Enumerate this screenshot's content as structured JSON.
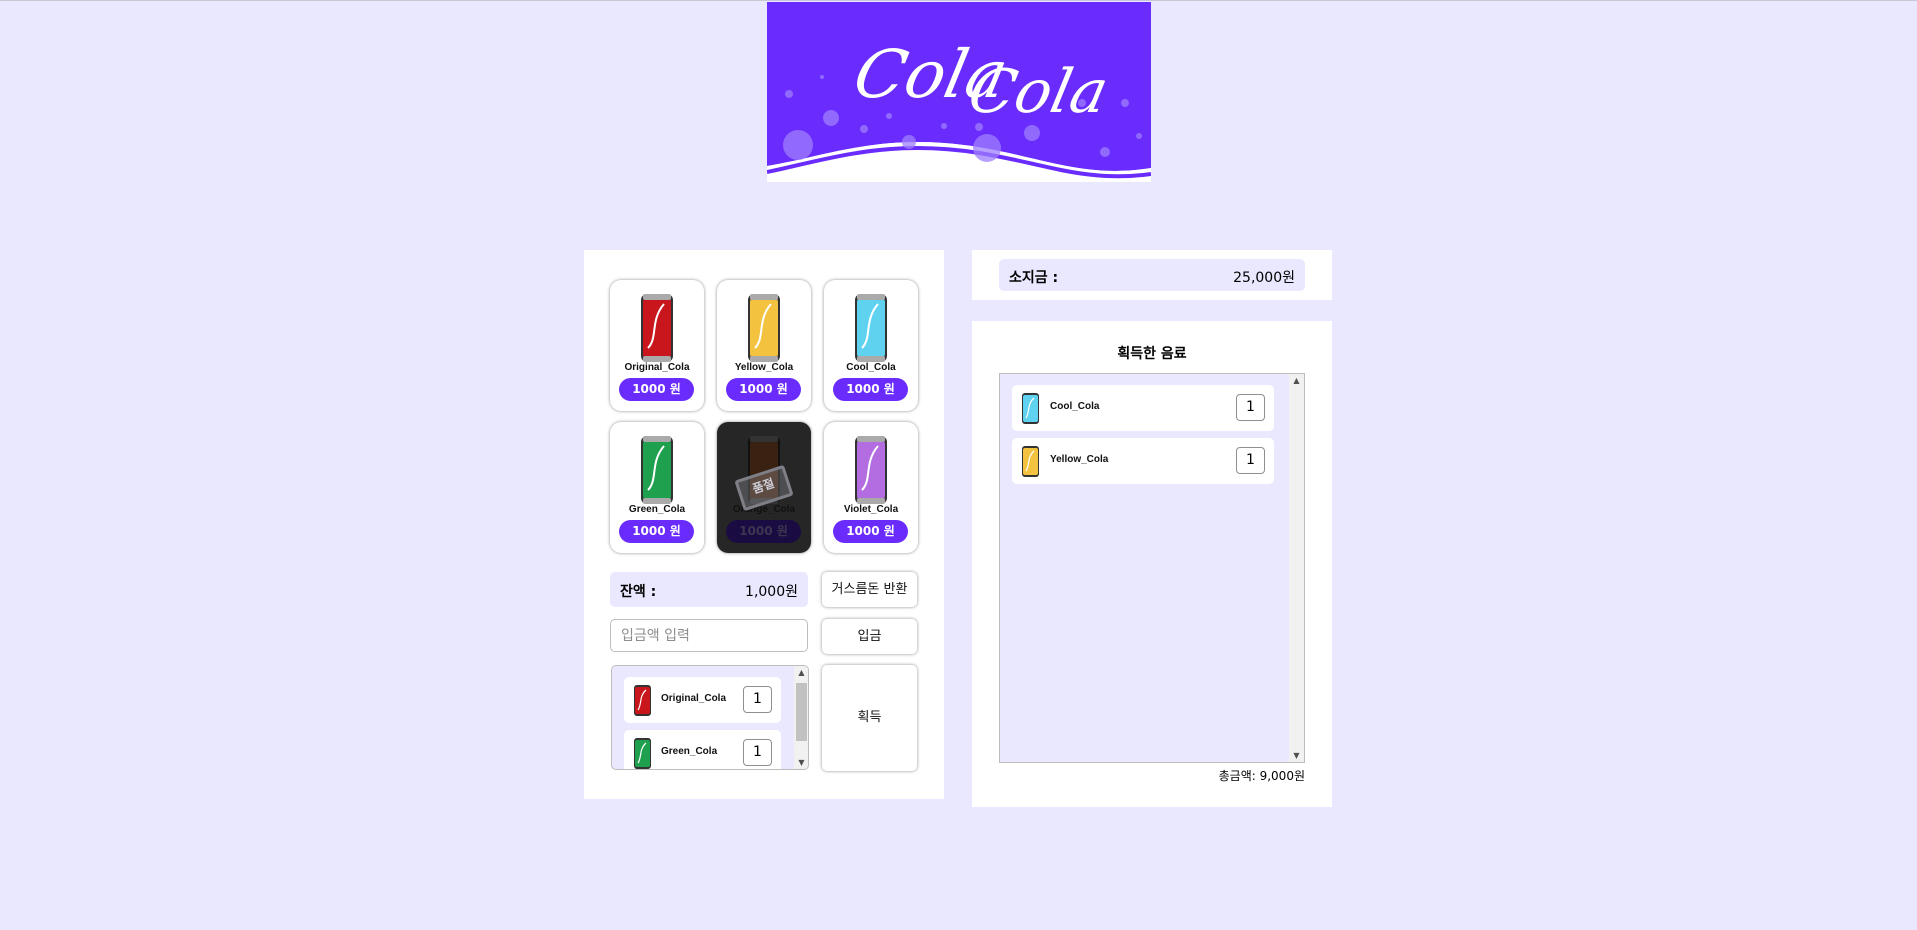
{
  "app": {
    "logo_text_1": "Cola",
    "logo_text_2": "Cola",
    "brand_color": "#6a2cfd",
    "background_color": "#eae8fe"
  },
  "vending_machine": {
    "items": [
      {
        "name": "Original_Cola",
        "price": "1000 원",
        "color": "#c8161c",
        "sold_out": false
      },
      {
        "name": "Yellow_Cola",
        "price": "1000 원",
        "color": "#f3c33f",
        "sold_out": false
      },
      {
        "name": "Cool_Cola",
        "price": "1000 원",
        "color": "#5fd2f0",
        "sold_out": false
      },
      {
        "name": "Green_Cola",
        "price": "1000 원",
        "color": "#1fa04f",
        "sold_out": false
      },
      {
        "name": "Orange_Cola",
        "price": "1000 원",
        "color": "#3a2212",
        "sold_out": true,
        "sold_out_label": "품절"
      },
      {
        "name": "Violet_Cola",
        "price": "1000 원",
        "color": "#b36de0",
        "sold_out": false
      }
    ],
    "balance_label": "잔액 :",
    "balance_value": "1,000원",
    "return_button": "거스름돈 반환",
    "deposit_placeholder": "입금액 입력",
    "deposit_button": "입금",
    "acquire_button": "획득",
    "cart": [
      {
        "name": "Original_Cola",
        "qty": "1",
        "color": "#c8161c"
      },
      {
        "name": "Green_Cola",
        "qty": "1",
        "color": "#1fa04f"
      }
    ]
  },
  "wallet": {
    "label": "소지금 :",
    "value": "25,000원"
  },
  "acquired": {
    "title": "획득한 음료",
    "items": [
      {
        "name": "Cool_Cola",
        "qty": "1",
        "color": "#5fd2f0"
      },
      {
        "name": "Yellow_Cola",
        "qty": "1",
        "color": "#f3c33f"
      }
    ],
    "total_label": "총금액: 9,000원"
  }
}
